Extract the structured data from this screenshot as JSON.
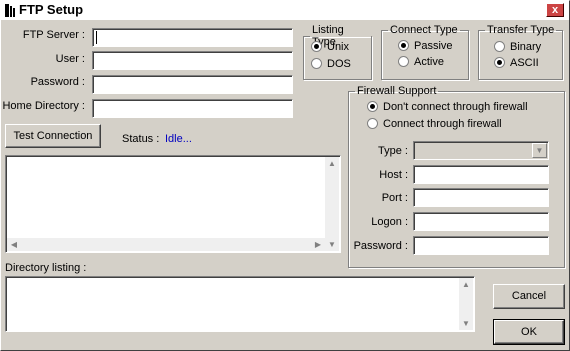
{
  "window": {
    "title": "FTP Setup",
    "close_glyph": "x"
  },
  "connection": {
    "server_label": "FTP Server :",
    "user_label": "User :",
    "password_label": "Password :",
    "home_label": "Home Directory :",
    "server_value": "",
    "user_value": "",
    "password_value": "",
    "home_value": ""
  },
  "listing_type": {
    "legend": "Listing Type",
    "unix": "Unix",
    "dos": "DOS",
    "selected": "unix"
  },
  "connect_type": {
    "legend": "Connect Type",
    "passive": "Passive",
    "active": "Active",
    "selected": "passive"
  },
  "transfer_type": {
    "legend": "Transfer Type",
    "binary": "Binary",
    "ascii": "ASCII",
    "selected": "ascii"
  },
  "test": {
    "button_label": "Test Connection",
    "status_label": "Status :",
    "status_value": "Idle..."
  },
  "firewall": {
    "legend": "Firewall Support",
    "no_firewall": "Don't connect through firewall",
    "through_firewall": "Connect through firewall",
    "selected": "no_firewall",
    "type_label": "Type :",
    "host_label": "Host :",
    "port_label": "Port :",
    "logon_label": "Logon :",
    "password_label": "Password :",
    "type_value": "",
    "host_value": "",
    "port_value": "",
    "logon_value": "",
    "password_value": ""
  },
  "directory": {
    "label": "Directory listing :"
  },
  "buttons": {
    "cancel": "Cancel",
    "ok": "OK"
  },
  "icons": {
    "app": "ftp-tool-icon",
    "close": "close-icon",
    "combo": "chevron-down-icon"
  }
}
